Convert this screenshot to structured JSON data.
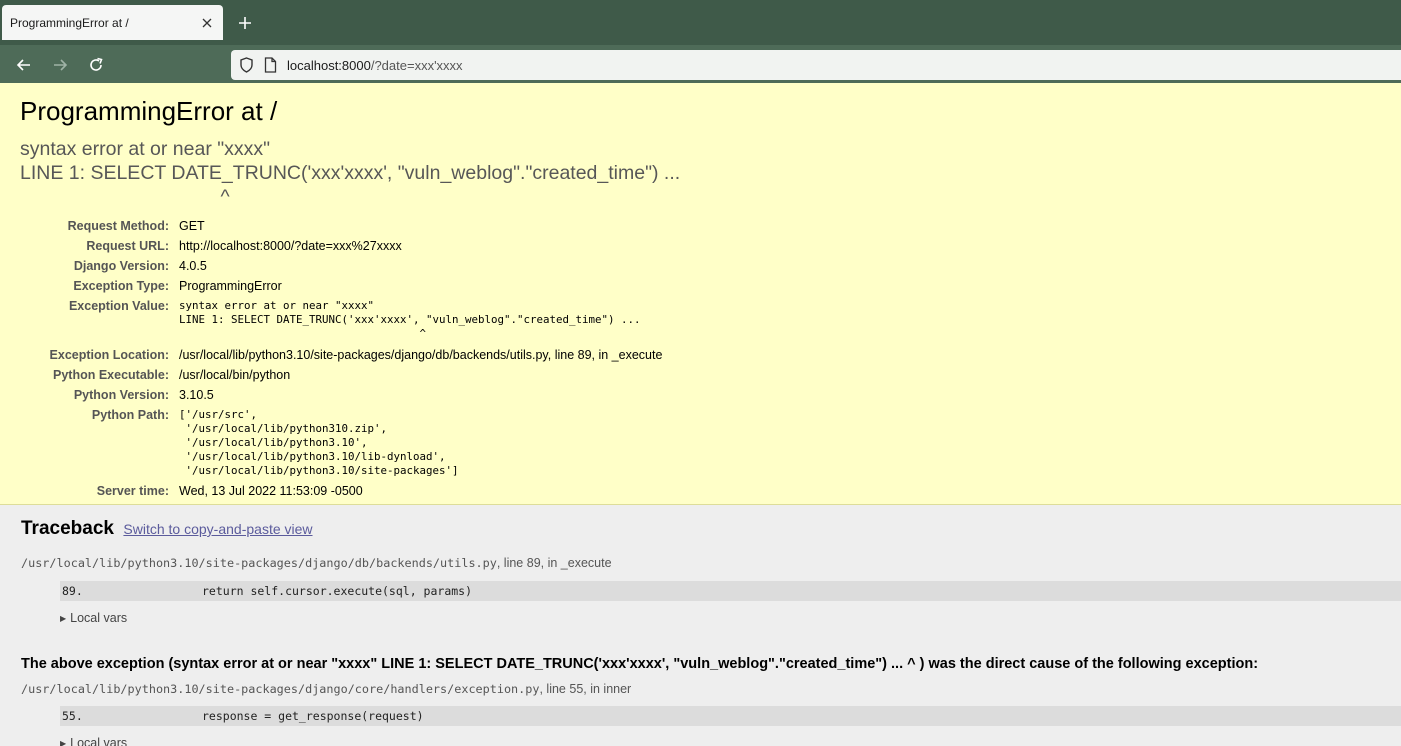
{
  "browser": {
    "tab_title": "ProgrammingError at /",
    "url_host": "localhost:8000",
    "url_path": "/?date=xxx'xxxx"
  },
  "summary": {
    "title": "ProgrammingError at /",
    "exception_value": "syntax error at or near \"xxxx\"\nLINE 1: SELECT DATE_TRUNC('xxx'xxxx', \"vuln_weblog\".\"created_time\") ...\n                                     ^",
    "meta": [
      {
        "key": "Request Method:",
        "value": "GET"
      },
      {
        "key": "Request URL:",
        "value": "http://localhost:8000/?date=xxx%27xxxx"
      },
      {
        "key": "Django Version:",
        "value": "4.0.5"
      },
      {
        "key": "Exception Type:",
        "value": "ProgrammingError"
      },
      {
        "key": "Exception Value:",
        "value": "syntax error at or near \"xxxx\"\nLINE 1: SELECT DATE_TRUNC('xxx'xxxx', \"vuln_weblog\".\"created_time\") ...\n                                     ^"
      },
      {
        "key": "Exception Location:",
        "value": "/usr/local/lib/python3.10/site-packages/django/db/backends/utils.py, line 89, in _execute"
      },
      {
        "key": "Python Executable:",
        "value": "/usr/local/bin/python"
      },
      {
        "key": "Python Version:",
        "value": "3.10.5"
      },
      {
        "key": "Python Path:",
        "value": "['/usr/src',\n '/usr/local/lib/python310.zip',\n '/usr/local/lib/python3.10',\n '/usr/local/lib/python3.10/lib-dynload',\n '/usr/local/lib/python3.10/site-packages']"
      },
      {
        "key": "Server time:",
        "value": "Wed, 13 Jul 2022 11:53:09 -0500"
      }
    ]
  },
  "traceback": {
    "title": "Traceback",
    "switch_link": "Switch to copy-and-paste view",
    "frames": [
      {
        "file": "/usr/local/lib/python3.10/site-packages/django/db/backends/utils.py",
        "location": ", line 89, in _execute",
        "line_no": "89.",
        "code": "return self.cursor.execute(sql, params)",
        "local_vars": "Local vars"
      },
      {
        "file": "/usr/local/lib/python3.10/site-packages/django/core/handlers/exception.py",
        "location": ", line 55, in inner",
        "line_no": "55.",
        "code": "response = get_response(request)",
        "local_vars": "Local vars"
      }
    ],
    "cause_text": "The above exception (syntax error at or near \"xxxx\" LINE 1: SELECT DATE_TRUNC('xxx'xxxx', \"vuln_weblog\".\"created_time\") ... ^ ) was the direct cause of the following exception:"
  }
}
